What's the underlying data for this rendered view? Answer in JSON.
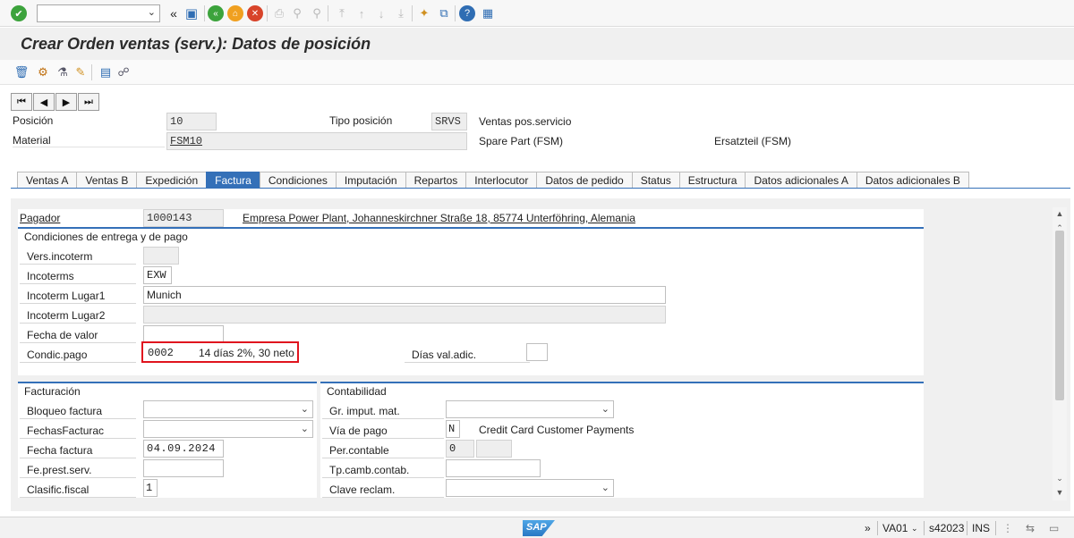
{
  "window": {
    "title": "Crear Orden ventas (serv.): Datos de posición"
  },
  "toolbar": {
    "command_value": "",
    "icons": [
      "enter-icon",
      "back-arrows-icon",
      "save-icon",
      "back-icon",
      "exit-icon",
      "cancel-icon",
      "print-icon",
      "find-icon",
      "find-next-icon",
      "first-page-icon",
      "prev-page-icon",
      "next-page-icon",
      "last-page-icon",
      "new-session-icon",
      "shortcut-icon",
      "help-icon",
      "customize-layout-icon"
    ]
  },
  "header": {
    "posicion_label": "Posición",
    "posicion_value": "10",
    "tipo_label": "Tipo posición",
    "tipo_value": "SRVS",
    "tipo_desc": "Ventas pos.servicio",
    "material_label": "Material",
    "material_value": "FSM10",
    "material_desc": "Spare Part (FSM)",
    "material_desc2": "Ersatzteil (FSM)"
  },
  "tabs": [
    "Ventas A",
    "Ventas B",
    "Expedición",
    "Factura",
    "Condiciones",
    "Imputación",
    "Repartos",
    "Interlocutor",
    "Datos de pedido",
    "Status",
    "Estructura",
    "Datos adicionales A",
    "Datos adicionales B"
  ],
  "active_tab": "Factura",
  "payer": {
    "label": "Pagador",
    "value": "1000143",
    "address": "Empresa Power Plant, Johanneskirchner Straße 18, 85774 Unterföhring, Alemania"
  },
  "entrega": {
    "title": "Condiciones de entrega y de pago",
    "vers_label": "Vers.incoterm",
    "vers_value": "",
    "incoterms_label": "Incoterms",
    "incoterms_value": "EXW",
    "lugar1_label": "Incoterm Lugar1",
    "lugar1_value": "Munich",
    "lugar2_label": "Incoterm Lugar2",
    "lugar2_value": "",
    "fecha_valor_label": "Fecha de valor",
    "fecha_valor_value": "",
    "condpago_label": "Condic.pago",
    "condpago_value": "0002",
    "condpago_desc": "14 días 2%, 30 neto",
    "dias_label": "Días val.adic.",
    "dias_value": ""
  },
  "facturacion": {
    "title": "Facturación",
    "bloqueo_label": "Bloqueo factura",
    "bloqueo_value": "",
    "fechas_label": "FechasFacturac",
    "fechas_value": "",
    "fecha_label": "Fecha factura",
    "fecha_value": "04.09.2024",
    "prest_label": "Fe.prest.serv.",
    "prest_value": "",
    "clasif_label": "Clasific.fiscal",
    "clasif_value": "1"
  },
  "contabilidad": {
    "title": "Contabilidad",
    "gr_label": "Gr. imput. mat.",
    "gr_value": "",
    "via_label": "Vía de pago",
    "via_value": "N",
    "via_desc": "Credit Card Customer Payments",
    "per_label": "Per.contable",
    "per_value": "0",
    "tp_label": "Tp.camb.contab.",
    "tp_value": "",
    "clave_label": "Clave reclam.",
    "clave_value": ""
  },
  "status": {
    "logo": "SAP",
    "arrows": "»",
    "transaction": "VA01",
    "server": "s42023",
    "mode": "INS"
  },
  "colors": {
    "accent": "#3470b8",
    "highlight": "#e0141e"
  }
}
